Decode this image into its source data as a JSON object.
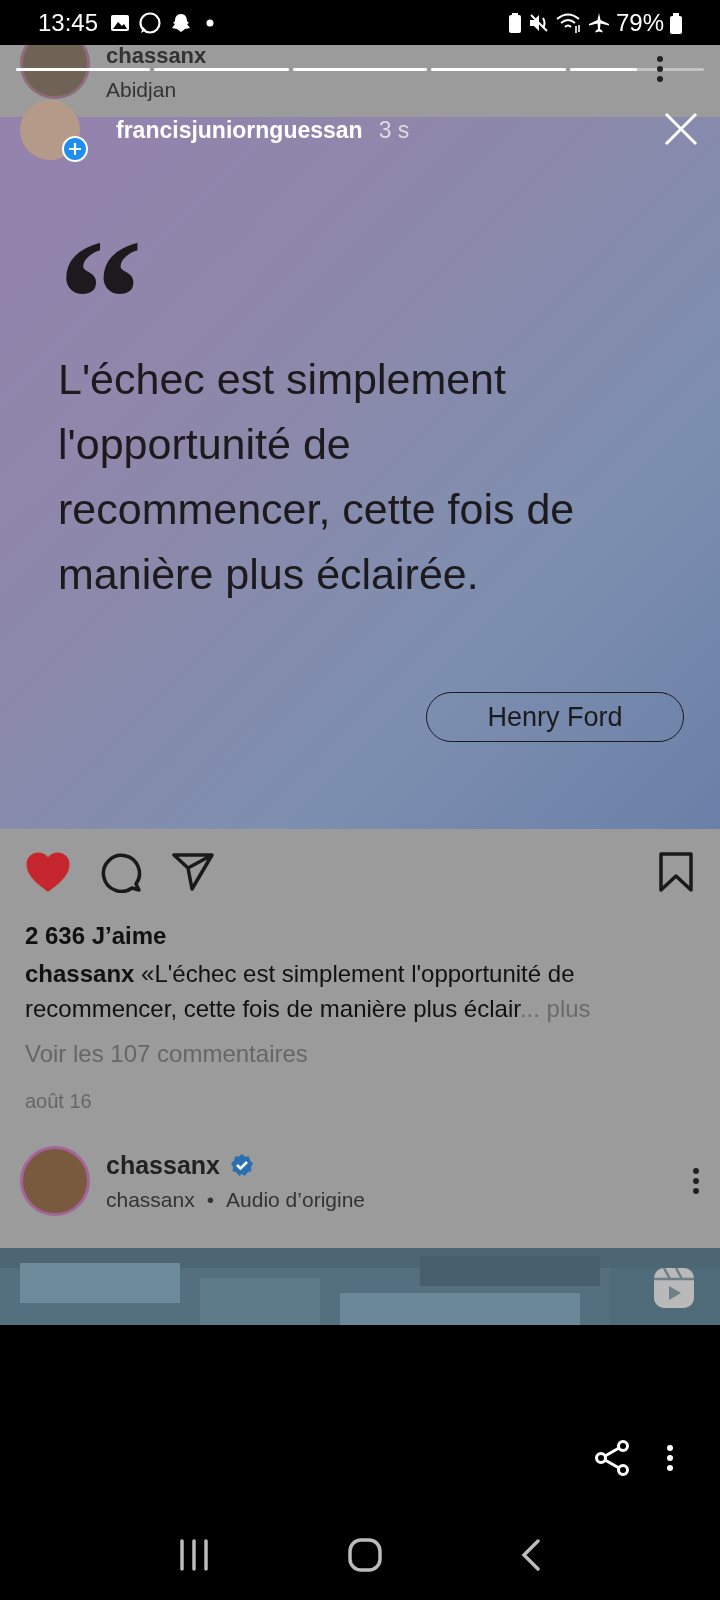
{
  "status_bar": {
    "time": "13:45",
    "battery": "79%"
  },
  "story": {
    "progress": [
      {
        "level": 1
      },
      {
        "level": 1
      },
      {
        "level": 1
      },
      {
        "level": 1
      },
      {
        "level": 0.5
      }
    ],
    "username": "francisjuniornguessan",
    "age": "3 s"
  },
  "post": {
    "author": "chassanx",
    "location": "Abidjan",
    "quote": {
      "mark": "“",
      "text": "L'échec est simplement l'opportunité de recommencer, cette fois de manière plus éclairée.",
      "attribution": "Henry Ford"
    },
    "liked": true,
    "likes": "2 636 J’aime",
    "caption_author": "chassanx",
    "caption": "«L'échec est simplement l'opportunité de recommencer, cette fois de manière plus éclair",
    "more": "... plus",
    "comments": "Voir les 107 commentaires",
    "date": "août 16"
  },
  "next_post": {
    "author": "chassanx",
    "verified": true,
    "subtitle_user": "chassanx",
    "separator": "•",
    "audio": "Audio d’origine"
  }
}
